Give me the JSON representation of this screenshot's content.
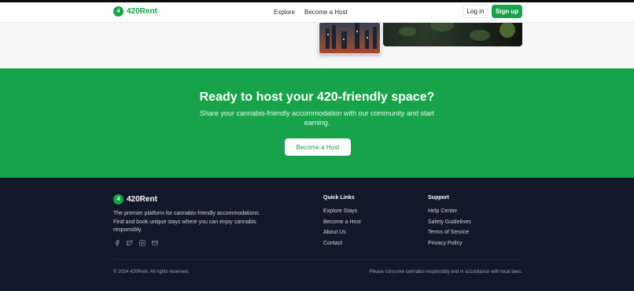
{
  "brand": {
    "badge": "4",
    "name": "420Rent"
  },
  "nav": {
    "explore": "Explore",
    "become_host": "Become a Host",
    "login": "Log in",
    "signup": "Sign up"
  },
  "cta": {
    "title": "Ready to host your 420-friendly space?",
    "subtitle": "Share your cannabis-friendly accommodation with our community and start earning.",
    "button": "Become a Host"
  },
  "footer": {
    "description": "The premier platform for cannabis-friendly accommodations. Find and book unique stays where you can enjoy cannabis responsibly.",
    "socials": [
      "facebook-icon",
      "twitter-icon",
      "instagram-icon",
      "mail-icon"
    ],
    "quick_links": {
      "title": "Quick Links",
      "items": [
        "Explore Stays",
        "Become a Host",
        "About Us",
        "Contact"
      ]
    },
    "support": {
      "title": "Support",
      "items": [
        "Help Center",
        "Safety Guidelines",
        "Terms of Service",
        "Privacy Policy"
      ]
    },
    "copyright": "© 2024 420Rent. All rights reserved.",
    "notice": "Please consume cannabis responsibly and in accordance with local laws."
  },
  "colors": {
    "brand_green": "#16a34a",
    "footer_bg": "#111827"
  }
}
